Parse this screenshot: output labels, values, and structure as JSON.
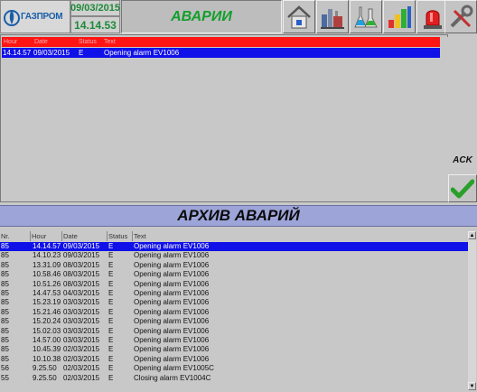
{
  "header": {
    "logo_text": "ГАЗПРОМ",
    "date": "09/03/2015",
    "time": "14.14.53",
    "title": "АВАРИИ"
  },
  "nav_icons": [
    "home-icon",
    "plant-icon",
    "lab-flask-icon",
    "bar-chart-icon",
    "alarm-beacon-icon",
    "tools-icon"
  ],
  "current_alarms": {
    "columns": [
      "Hour",
      "Date",
      "Status",
      "Text"
    ],
    "rows": [
      {
        "hour": "14.14.57",
        "date": "09/03/2015",
        "status": "E",
        "text": "Opening alarm EV1006"
      }
    ]
  },
  "ack": {
    "label": "ACK"
  },
  "archive": {
    "title": "АРХИВ АВАРИЙ",
    "columns": [
      "Nr.",
      "Hour",
      "Date",
      "Status",
      "Text"
    ],
    "rows": [
      {
        "nr": "85",
        "hour": "14.14.57",
        "date": "09/03/2015",
        "status": "E",
        "text": "Opening alarm EV1006",
        "selected": true
      },
      {
        "nr": "85",
        "hour": "14.10.23",
        "date": "09/03/2015",
        "status": "E",
        "text": "Opening alarm EV1006"
      },
      {
        "nr": "85",
        "hour": "13.31.09",
        "date": "08/03/2015",
        "status": "E",
        "text": "Opening alarm EV1006"
      },
      {
        "nr": "85",
        "hour": "10.58.46",
        "date": "08/03/2015",
        "status": "E",
        "text": "Opening alarm EV1006"
      },
      {
        "nr": "85",
        "hour": "10.51.26",
        "date": "08/03/2015",
        "status": "E",
        "text": "Opening alarm EV1006"
      },
      {
        "nr": "85",
        "hour": "14.47.53",
        "date": "04/03/2015",
        "status": "E",
        "text": "Opening alarm EV1006"
      },
      {
        "nr": "85",
        "hour": "15.23.19",
        "date": "03/03/2015",
        "status": "E",
        "text": "Opening alarm EV1006"
      },
      {
        "nr": "85",
        "hour": "15.21.46",
        "date": "03/03/2015",
        "status": "E",
        "text": "Opening alarm EV1006"
      },
      {
        "nr": "85",
        "hour": "15.20.24",
        "date": "03/03/2015",
        "status": "E",
        "text": "Opening alarm EV1006"
      },
      {
        "nr": "85",
        "hour": "15.02.03",
        "date": "03/03/2015",
        "status": "E",
        "text": "Opening alarm EV1006"
      },
      {
        "nr": "85",
        "hour": "14.57.00",
        "date": "03/03/2015",
        "status": "E",
        "text": "Opening alarm EV1006"
      },
      {
        "nr": "85",
        "hour": "10.45.39",
        "date": "02/03/2015",
        "status": "E",
        "text": "Opening alarm EV1006"
      },
      {
        "nr": "85",
        "hour": "10.10.38",
        "date": "02/03/2015",
        "status": "E",
        "text": "Opening alarm EV1006"
      },
      {
        "nr": "56",
        "hour": "9.25.50",
        "date": "02/03/2015",
        "status": "E",
        "text": "Opening alarm EV1005C"
      },
      {
        "nr": "55",
        "hour": "9.25.50",
        "date": "02/03/2015",
        "status": "E",
        "text": "Closing alarm EV1004C"
      }
    ]
  }
}
